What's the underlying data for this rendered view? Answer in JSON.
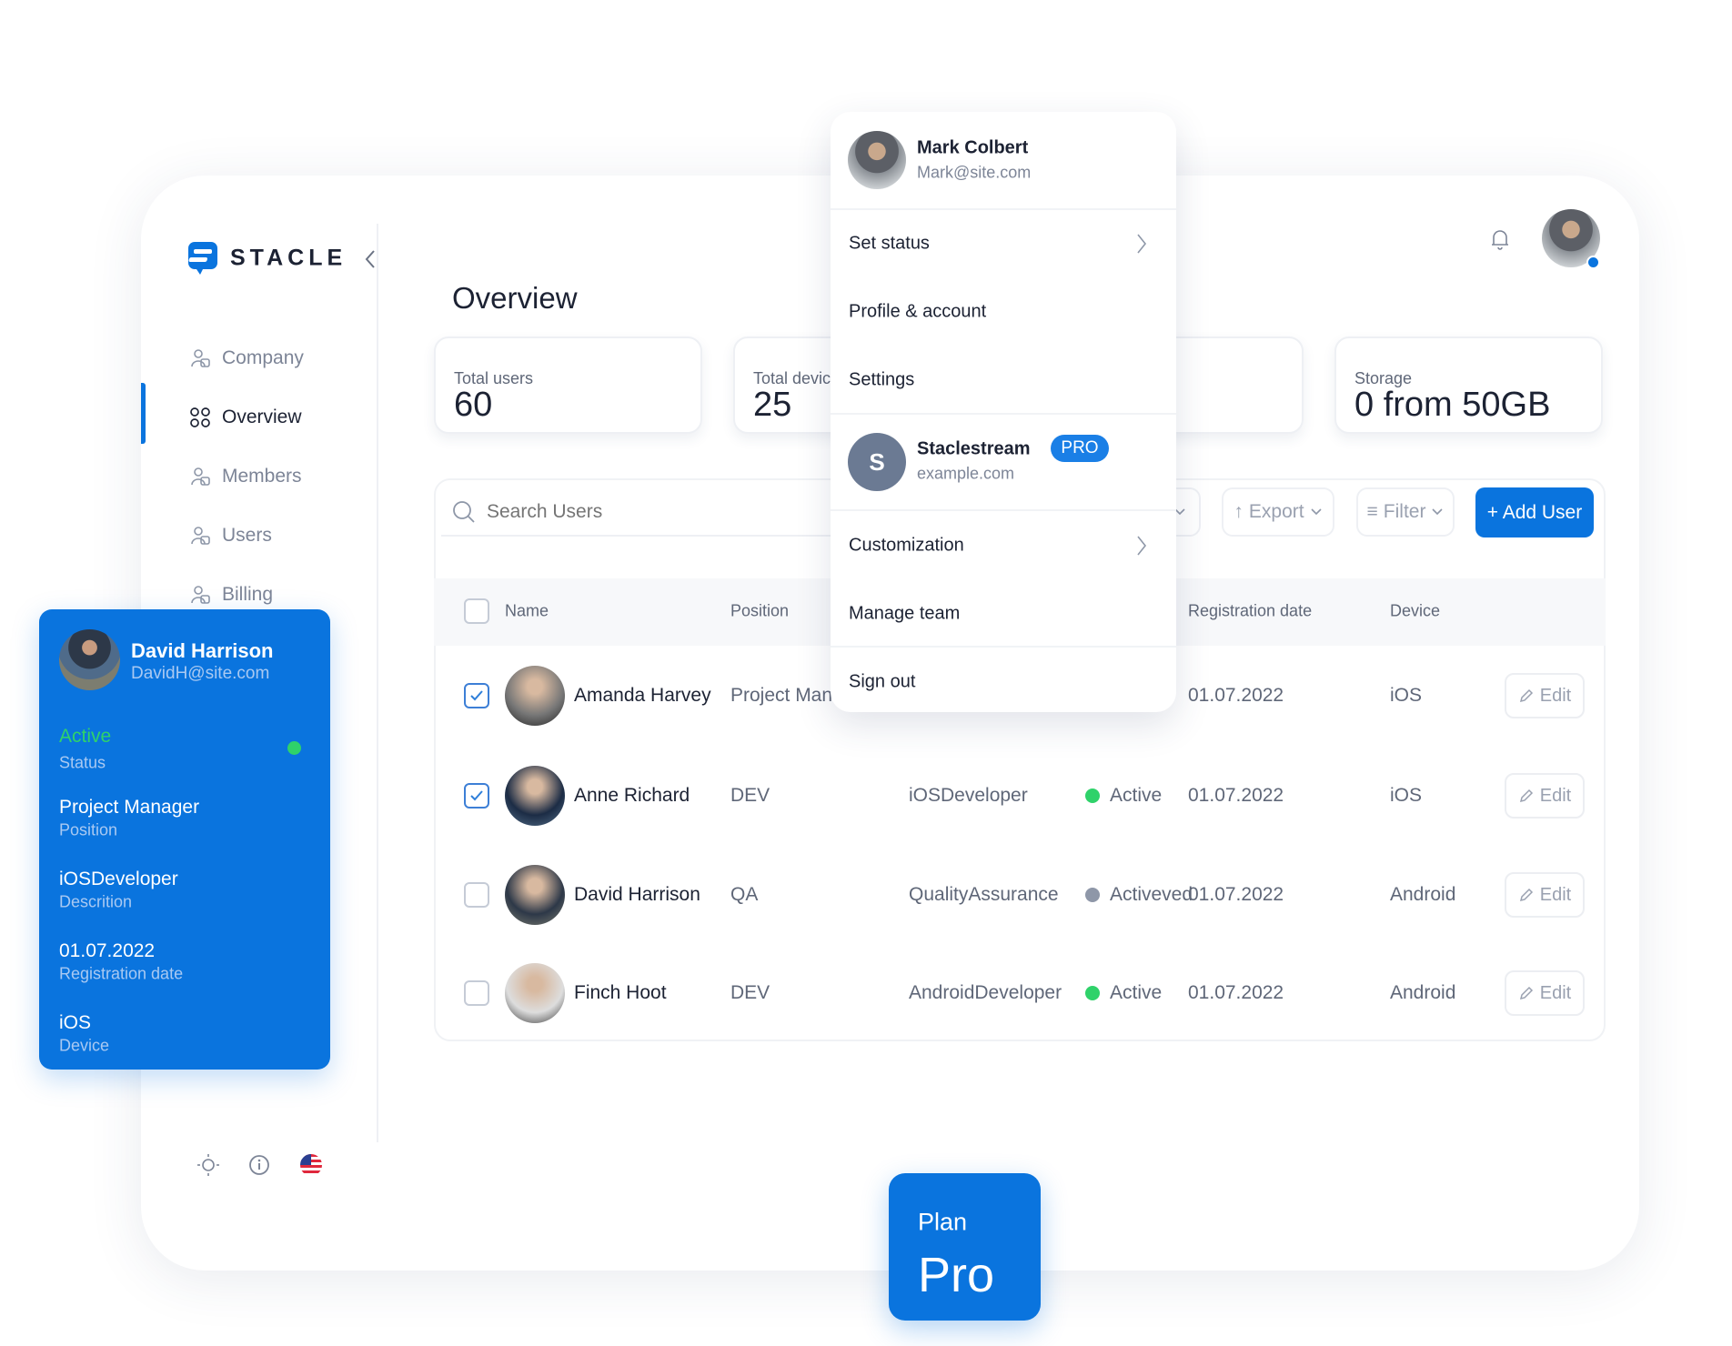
{
  "colors": {
    "accent": "#0a74de",
    "active": "#2fd26a",
    "inactive": "#8e97a8"
  },
  "brand": {
    "name": "STACLE"
  },
  "sidebar": {
    "items": [
      {
        "label": "Company",
        "icon": "building-icon"
      },
      {
        "label": "Overview",
        "icon": "grid-icon",
        "active": true
      },
      {
        "label": "Members",
        "icon": "members-icon"
      },
      {
        "label": "Users",
        "icon": "users-icon"
      },
      {
        "label": "Billing",
        "icon": "wallet-icon"
      }
    ],
    "footer_icons": [
      "sun-icon",
      "info-icon",
      "us-flag-icon"
    ]
  },
  "page": {
    "title": "Overview"
  },
  "stats": [
    {
      "label": "Total users",
      "value": "60"
    },
    {
      "label": "Total devic",
      "value": "25"
    },
    {
      "label": "",
      "value": ""
    },
    {
      "label": "Storage",
      "value": "0 from 50GB"
    }
  ],
  "toolbar": {
    "search_placeholder": "Search Users",
    "export": "Export",
    "filter": "Filter",
    "add_user": "+ Add User"
  },
  "table": {
    "headers": {
      "name": "Name",
      "position": "Position",
      "registration": "Registration date",
      "device": "Device"
    },
    "edit_label": "Edit",
    "rows": [
      {
        "name": "Amanda Harvey",
        "position": "Project Man",
        "description": "",
        "status": "",
        "status_color": "",
        "date": "01.07.2022",
        "device": "iOS",
        "checked": true
      },
      {
        "name": "Anne Richard",
        "position": "DEV",
        "description": "iOSDeveloper",
        "status": "Active",
        "status_color": "#2fd26a",
        "date": "01.07.2022",
        "device": "iOS",
        "checked": true
      },
      {
        "name": "David Harrison",
        "position": "QA",
        "description": "QualityAssurance",
        "status": "Activeved",
        "status_color": "#8e97a8",
        "date": "01.07.2022",
        "device": "Android",
        "checked": false
      },
      {
        "name": "Finch Hoot",
        "position": "DEV",
        "description": "AndroidDeveloper",
        "status": "Active",
        "status_color": "#2fd26a",
        "date": "01.07.2022",
        "device": "Android",
        "checked": false
      }
    ]
  },
  "menu": {
    "user": {
      "name": "Mark Colbert",
      "email": "Mark@site.com"
    },
    "set_status": "Set status",
    "profile": "Profile & account",
    "settings": "Settings",
    "workspace": {
      "initial": "S",
      "name": "Staclestream",
      "badge": "PRO",
      "domain": "example.com"
    },
    "customization": "Customization",
    "manage_team": "Manage team",
    "sign_out": "Sign out"
  },
  "user_card": {
    "name": "David Harrison",
    "email": "DavidH@site.com",
    "status": "Active",
    "status_label": "Status",
    "position": "Project Manager",
    "position_label": "Position",
    "description": "iOSDeveloper",
    "description_label": "Descrition",
    "date": "01.07.2022",
    "date_label": "Registration date",
    "device": "iOS",
    "device_label": "Device"
  },
  "plan": {
    "label": "Plan",
    "name": "Pro"
  }
}
